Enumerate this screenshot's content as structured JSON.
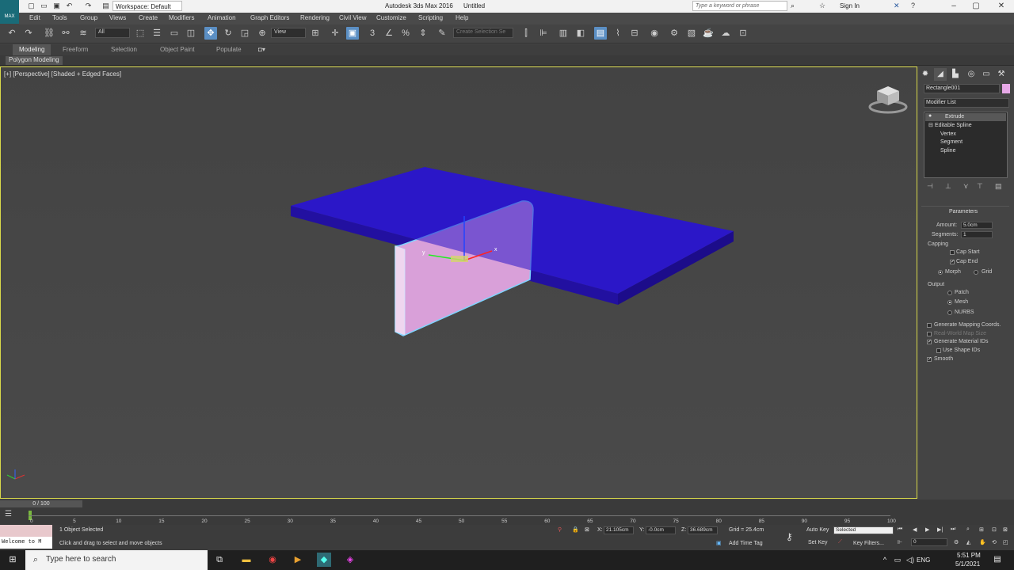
{
  "title": {
    "app": "Autodesk 3ds Max 2016",
    "doc": "Untitled",
    "workspace": "Workspace: Default",
    "search_placeholder": "Type a keyword or phrase",
    "signin": "Sign In"
  },
  "logo": "MAX",
  "menu": [
    "Edit",
    "Tools",
    "Group",
    "Views",
    "Create",
    "Modifiers",
    "Animation",
    "Graph Editors",
    "Rendering",
    "Civil View",
    "Customize",
    "Scripting",
    "Help"
  ],
  "toolbar": {
    "filter": "All",
    "refcoord": "View",
    "selset": "Create Selection Se"
  },
  "ribbon": {
    "tabs": [
      "Modeling",
      "Freeform",
      "Selection",
      "Object Paint",
      "Populate"
    ],
    "sub": "Polygon Modeling"
  },
  "viewport": {
    "label": "[+] [Perspective] [Shaded + Edged Faces]",
    "axes": {
      "x": "x",
      "y": "y",
      "z": "z"
    }
  },
  "cmd": {
    "object_name": "Rectangle001",
    "modifier_list": "Modifier List",
    "stack": [
      "Extrude",
      "Editable Spline",
      "Vertex",
      "Segment",
      "Spline"
    ],
    "params": {
      "title": "Parameters",
      "amount_label": "Amount:",
      "amount": "5.0cm",
      "segments_label": "Segments:",
      "segments": "1",
      "capping": "Capping",
      "cap_start": "Cap Start",
      "cap_end": "Cap End",
      "morph": "Morph",
      "grid": "Grid",
      "output": "Output",
      "patch": "Patch",
      "mesh": "Mesh",
      "nurbs": "NURBS",
      "gen_mapping": "Generate Mapping Coords.",
      "real_world": "Real-World Map Size",
      "gen_matids": "Generate Material IDs",
      "use_shape_ids": "Use Shape IDs",
      "smooth": "Smooth"
    },
    "checks": {
      "cap_start": false,
      "cap_end": true,
      "gen_mapping": false,
      "real_world": false,
      "gen_matids": true,
      "use_shape_ids": false,
      "smooth": true
    }
  },
  "timeline": {
    "frame": "0 / 100",
    "ticks": [
      "0",
      "5",
      "10",
      "15",
      "20",
      "25",
      "30",
      "35",
      "40",
      "45",
      "50",
      "55",
      "60",
      "65",
      "70",
      "75",
      "80",
      "85",
      "90",
      "95",
      "100"
    ]
  },
  "status": {
    "maxscript": "Welcome to M",
    "selected": "1 Object Selected",
    "prompt": "Click and drag to select and move objects",
    "x_label": "X:",
    "x": "21.105cm",
    "y_label": "Y:",
    "y": "-0.0cm",
    "z_label": "Z:",
    "z": "36.689cm",
    "grid": "Grid = 25.4cm",
    "add_time_tag": "Add Time Tag",
    "auto_key": "Auto Key",
    "set_key": "Set Key",
    "selected_dd": "Selected",
    "key_filters": "Key Filters...",
    "frame_field": "0"
  },
  "taskbar": {
    "search": "Type here to search",
    "time": "5:51 PM",
    "date": "5/1/2021",
    "lang": "ENG"
  }
}
